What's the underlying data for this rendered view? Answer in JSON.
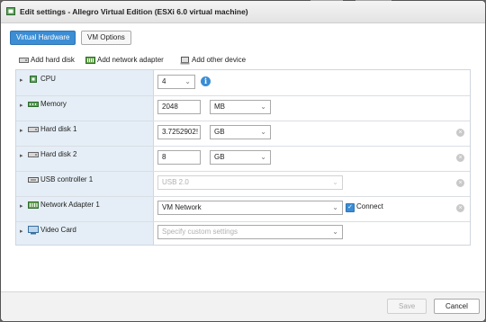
{
  "dialog": {
    "title": "Edit settings - Allegro Virtual Edition (ESXi 6.0 virtual machine)"
  },
  "tabs": [
    {
      "label": "Virtual Hardware",
      "active": true
    },
    {
      "label": "VM Options",
      "active": false
    }
  ],
  "toolbar": {
    "add_hard_disk": "Add hard disk",
    "add_network_adapter": "Add network adapter",
    "add_other_device": "Add other device"
  },
  "hardware": {
    "cpu": {
      "label": "CPU",
      "value": "4"
    },
    "memory": {
      "label": "Memory",
      "value": "2048",
      "unit": "MB"
    },
    "hard_disk_1": {
      "label": "Hard disk 1",
      "value": "3.7252902!",
      "unit": "GB"
    },
    "hard_disk_2": {
      "label": "Hard disk 2",
      "value": "8",
      "unit": "GB"
    },
    "usb_controller": {
      "label": "USB controller 1",
      "value": "USB 2.0"
    },
    "network_adapter": {
      "label": "Network Adapter 1",
      "value": "VM Network",
      "connect_label": "Connect",
      "connected": true
    },
    "video_card": {
      "label": "Video Card",
      "value": "Specify custom settings"
    }
  },
  "footer": {
    "save_label": "Save",
    "cancel_label": "Cancel"
  },
  "colors": {
    "accent": "#3b8dd4",
    "label_column": "#e5eef6"
  }
}
